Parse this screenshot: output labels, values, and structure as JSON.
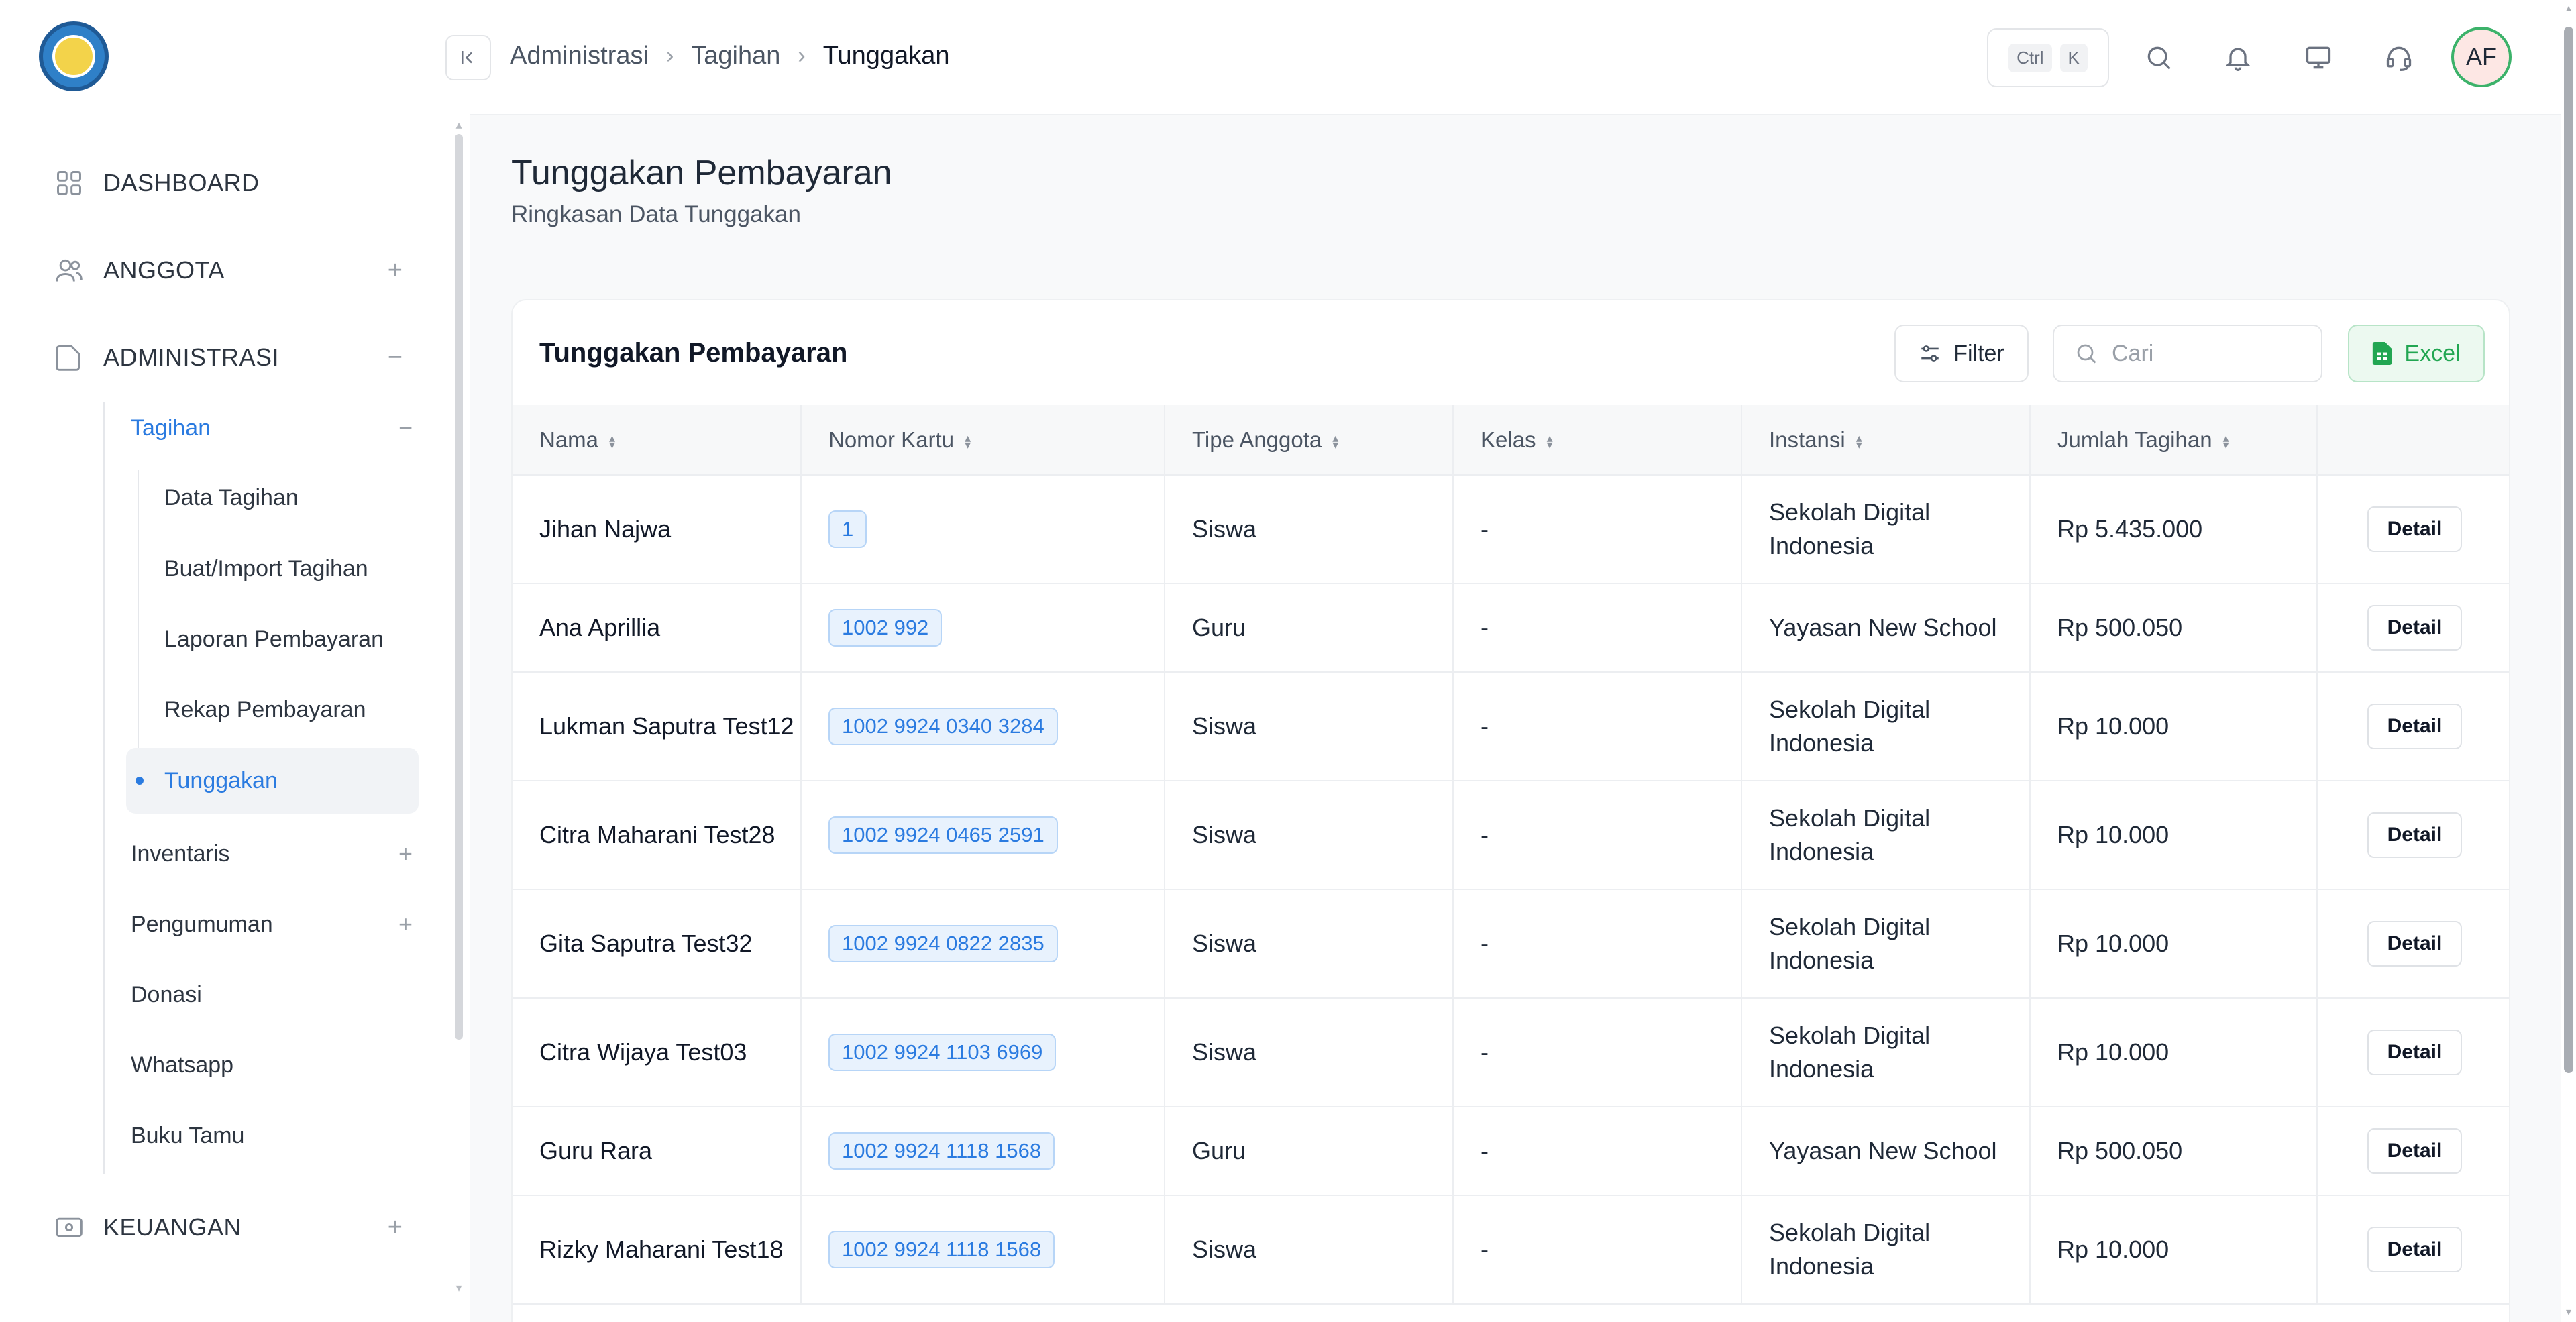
{
  "header": {
    "breadcrumb": [
      "Administrasi",
      "Tagihan",
      "Tunggakan"
    ],
    "shortcut_keys": [
      "Ctrl",
      "K"
    ],
    "avatar_initials": "AF"
  },
  "sidebar": {
    "top_items": [
      {
        "label": "DASHBOARD",
        "icon": "grid-icon"
      },
      {
        "label": "ANGGOTA",
        "icon": "users-icon",
        "toggle": "+"
      },
      {
        "label": "ADMINISTRASI",
        "icon": "folder-icon",
        "toggle": "−"
      }
    ],
    "admin_sub": [
      {
        "label": "Tagihan",
        "toggle": "−"
      },
      {
        "label": "Inventaris",
        "toggle": "+"
      },
      {
        "label": "Pengumuman",
        "toggle": "+"
      },
      {
        "label": "Donasi"
      },
      {
        "label": "Whatsapp"
      },
      {
        "label": "Buku Tamu"
      }
    ],
    "tagihan_sub": [
      "Data Tagihan",
      "Buat/Import Tagihan",
      "Laporan Pembayaran",
      "Rekap Pembayaran",
      "Tunggakan"
    ],
    "keuangan": {
      "label": "KEUANGAN",
      "icon": "wallet-icon",
      "toggle": "+"
    }
  },
  "page": {
    "title": "Tunggakan Pembayaran",
    "subtitle": "Ringkasan Data Tunggakan"
  },
  "card": {
    "title": "Tunggakan Pembayaran",
    "filter_label": "Filter",
    "search_placeholder": "Cari",
    "excel_label": "Excel"
  },
  "table": {
    "columns": [
      "Nama",
      "Nomor Kartu",
      "Tipe Anggota",
      "Kelas",
      "Instansi",
      "Jumlah Tagihan",
      ""
    ],
    "detail_label": "Detail",
    "rows": [
      {
        "nama": "Jihan Najwa",
        "kartu": "1",
        "tipe": "Siswa",
        "kelas": "-",
        "instansi": "Sekolah Digital Indonesia",
        "jumlah": "Rp 5.435.000"
      },
      {
        "nama": "Ana Aprillia",
        "kartu": "1002 992",
        "tipe": "Guru",
        "kelas": "-",
        "instansi": "Yayasan New School",
        "jumlah": "Rp 500.050"
      },
      {
        "nama": "Lukman Saputra Test12",
        "kartu": "1002 9924 0340 3284",
        "tipe": "Siswa",
        "kelas": "-",
        "instansi": "Sekolah Digital Indonesia",
        "jumlah": "Rp 10.000"
      },
      {
        "nama": "Citra Maharani Test28",
        "kartu": "1002 9924 0465 2591",
        "tipe": "Siswa",
        "kelas": "-",
        "instansi": "Sekolah Digital Indonesia",
        "jumlah": "Rp 10.000"
      },
      {
        "nama": "Gita Saputra Test32",
        "kartu": "1002 9924 0822 2835",
        "tipe": "Siswa",
        "kelas": "-",
        "instansi": "Sekolah Digital Indonesia",
        "jumlah": "Rp 10.000"
      },
      {
        "nama": "Citra Wijaya Test03",
        "kartu": "1002 9924 1103 6969",
        "tipe": "Siswa",
        "kelas": "-",
        "instansi": "Sekolah Digital Indonesia",
        "jumlah": "Rp 10.000"
      },
      {
        "nama": "Guru Rara",
        "kartu": "1002 9924 1118 1568",
        "tipe": "Guru",
        "kelas": "-",
        "instansi": "Yayasan New School",
        "jumlah": "Rp 500.050"
      },
      {
        "nama": "Rizky Maharani Test18",
        "kartu": "1002 9924 1118 1568",
        "tipe": "Siswa",
        "kelas": "-",
        "instansi": "Sekolah Digital Indonesia",
        "jumlah": "Rp 10.000"
      }
    ]
  }
}
